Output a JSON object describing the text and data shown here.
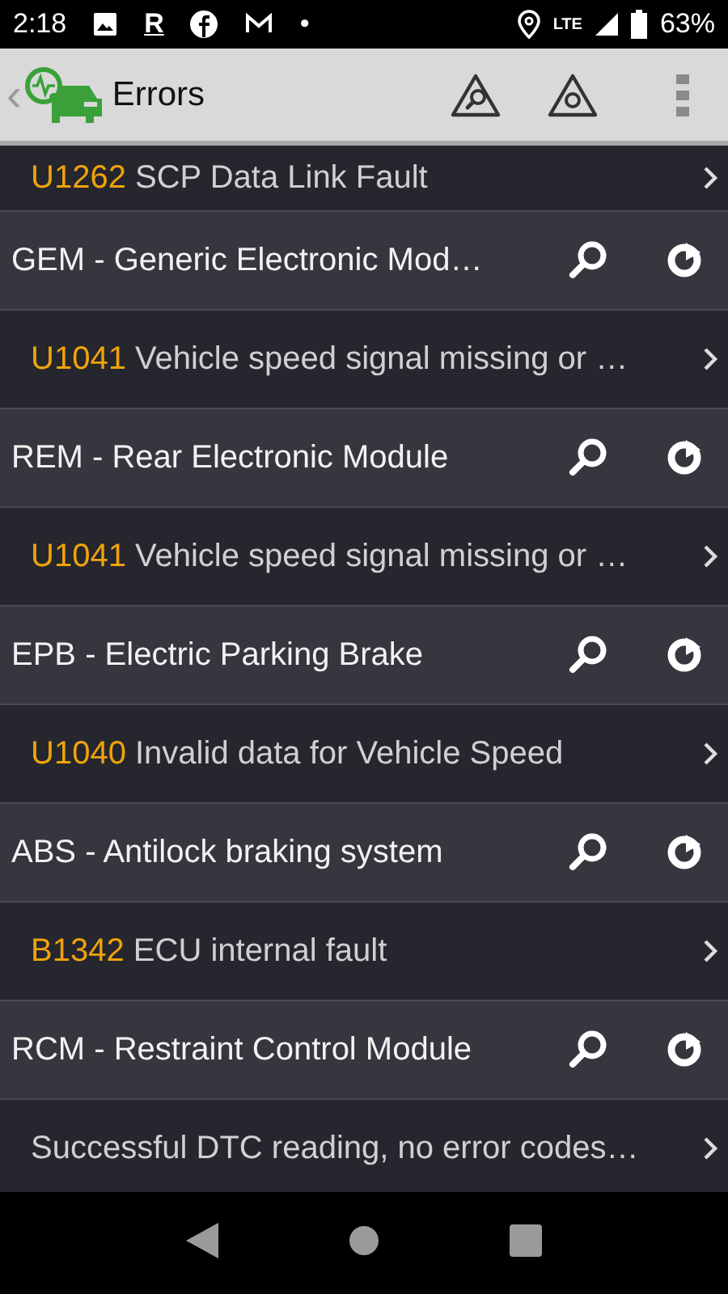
{
  "status_bar": {
    "time": "2:18",
    "notification_letter": "R",
    "more_dot": "•",
    "network": "LTE",
    "battery": "63%"
  },
  "app_bar": {
    "back": "‹",
    "title": "Errors"
  },
  "items": [
    {
      "kind": "error",
      "code": "U1262",
      "text": "SCP Data Link Fault"
    },
    {
      "kind": "module",
      "text": "GEM - Generic Electronic Mod…"
    },
    {
      "kind": "error",
      "code": "U1041",
      "text": "Vehicle speed signal missing or …"
    },
    {
      "kind": "module",
      "text": "REM - Rear Electronic Module"
    },
    {
      "kind": "error",
      "code": "U1041",
      "text": "Vehicle speed signal missing or …"
    },
    {
      "kind": "module",
      "text": "EPB - Electric Parking Brake"
    },
    {
      "kind": "error",
      "code": "U1040",
      "text": "Invalid data for Vehicle Speed"
    },
    {
      "kind": "module",
      "text": "ABS - Antilock braking system"
    },
    {
      "kind": "error",
      "code": "B1342",
      "text": "ECU internal fault"
    },
    {
      "kind": "module",
      "text": "RCM - Restraint Control Module"
    },
    {
      "kind": "error",
      "text": "Successful DTC reading, no error codes…"
    }
  ]
}
